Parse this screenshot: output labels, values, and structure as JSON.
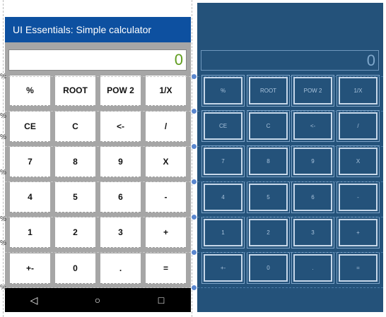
{
  "app": {
    "title": "UI Essentials: Simple calculator"
  },
  "display": {
    "value": "0"
  },
  "keys": [
    [
      "%",
      "ROOT",
      "POW 2",
      "1/X"
    ],
    [
      "CE",
      "C",
      "<-",
      "/"
    ],
    [
      "7",
      "8",
      "9",
      "X"
    ],
    [
      "4",
      "5",
      "6",
      "-"
    ],
    [
      "1",
      "2",
      "3",
      "+"
    ],
    [
      "+-",
      "0",
      ".",
      "="
    ]
  ],
  "navbar": {
    "back": "◁",
    "home": "○",
    "recent": "□"
  },
  "edge_marks": [
    "%",
    "%",
    "%",
    "%",
    "%",
    "%",
    "%",
    "%"
  ],
  "colors": {
    "app_bar": "#0d50a0",
    "display_text": "#5f9c1e",
    "blueprint_bg": "#24527a"
  }
}
